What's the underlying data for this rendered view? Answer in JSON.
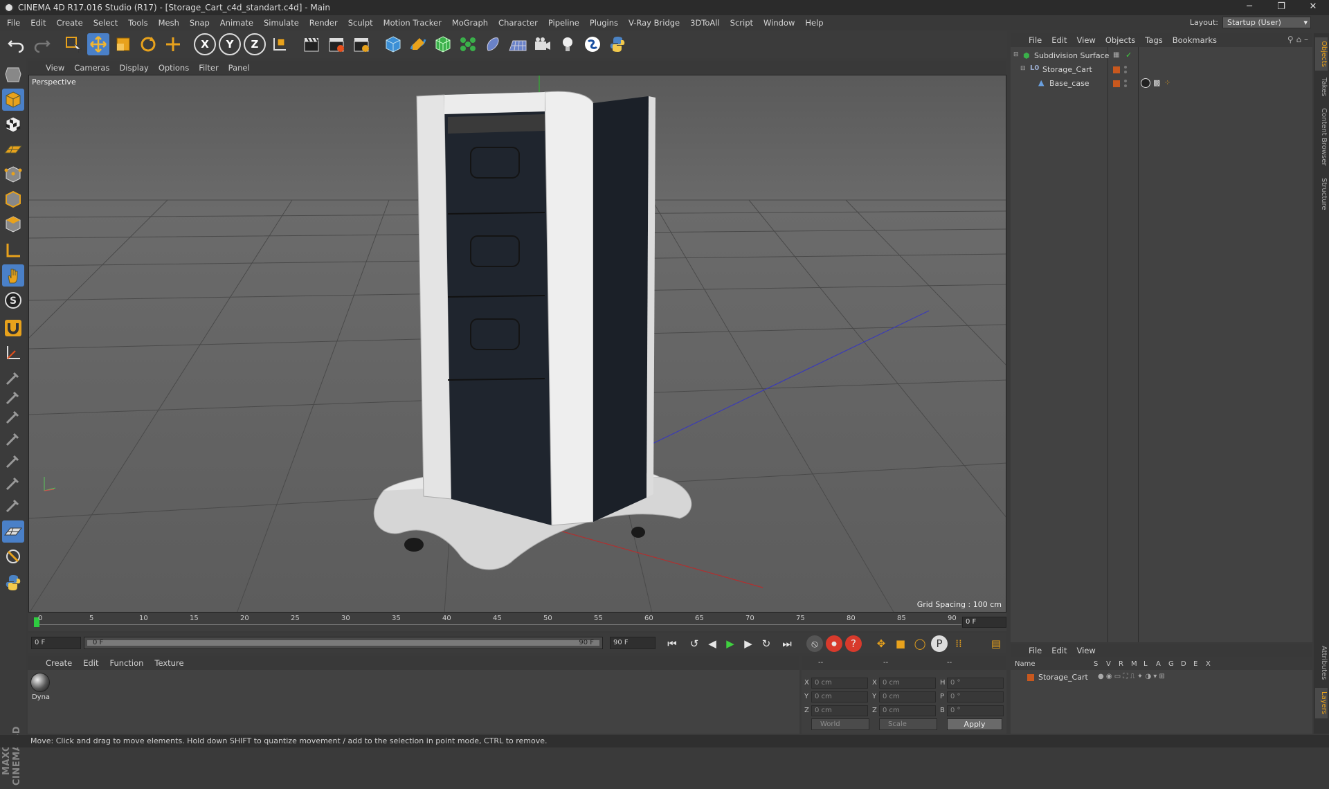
{
  "window": {
    "title": "CINEMA 4D R17.016 Studio (R17) - [Storage_Cart_c4d_standart.c4d] - Main",
    "controls": [
      "─",
      "❐",
      "✕"
    ]
  },
  "menubar": {
    "items": [
      "File",
      "Edit",
      "Create",
      "Select",
      "Tools",
      "Mesh",
      "Snap",
      "Animate",
      "Simulate",
      "Render",
      "Sculpt",
      "Motion Tracker",
      "MoGraph",
      "Character",
      "Pipeline",
      "Plugins",
      "V-Ray Bridge",
      "3DToAll",
      "Script",
      "Window",
      "Help"
    ],
    "layout_label": "Layout:",
    "layout_value": "Startup (User)"
  },
  "toolbar": {
    "x_label": "X",
    "y_label": "Y",
    "z_label": "Z"
  },
  "viewport": {
    "menu": [
      "View",
      "Cameras",
      "Display",
      "Options",
      "Filter",
      "Panel"
    ],
    "label": "Perspective",
    "grid_spacing": "Grid Spacing : 100 cm"
  },
  "timeline": {
    "ticks": [
      "0",
      "5",
      "10",
      "15",
      "20",
      "25",
      "30",
      "35",
      "40",
      "45",
      "50",
      "55",
      "60",
      "65",
      "70",
      "75",
      "80",
      "85",
      "90"
    ],
    "current_frame": "0 F"
  },
  "transport": {
    "start_field": "0 F",
    "range_start": "0 F",
    "range_end": "90 F",
    "end_field": "90 F"
  },
  "material_manager": {
    "menu": [
      "Create",
      "Edit",
      "Function",
      "Texture"
    ],
    "materials": [
      {
        "name": "Dyna"
      }
    ]
  },
  "coordinates": {
    "header_cols": [
      "--",
      "--",
      "--"
    ],
    "rows": [
      {
        "l1": "X",
        "v1": "0 cm",
        "l2": "X",
        "v2": "0 cm",
        "l3": "H",
        "v3": "0 °"
      },
      {
        "l1": "Y",
        "v1": "0 cm",
        "l2": "Y",
        "v2": "0 cm",
        "l3": "P",
        "v3": "0 °"
      },
      {
        "l1": "Z",
        "v1": "0 cm",
        "l2": "Z",
        "v2": "0 cm",
        "l3": "B",
        "v3": "0 °"
      }
    ],
    "space": "World",
    "mode": "Scale",
    "apply_label": "Apply"
  },
  "status": {
    "text": "Move: Click and drag to move elements. Hold down SHIFT to quantize movement / add to the selection in point mode, CTRL to remove."
  },
  "object_manager": {
    "menu": [
      "File",
      "Edit",
      "View",
      "Objects",
      "Tags",
      "Bookmarks"
    ],
    "objects": [
      {
        "name": "Subdivision Surface"
      },
      {
        "name": "Storage_Cart"
      },
      {
        "name": "Base_case"
      }
    ]
  },
  "side_tabs": [
    "Objects",
    "Takes",
    "Content Browser",
    "Structure",
    "Attributes",
    "Layers"
  ],
  "layer_manager": {
    "menu": [
      "File",
      "Edit",
      "View"
    ],
    "columns": [
      "Name",
      "S",
      "V",
      "R",
      "M",
      "L",
      "A",
      "G",
      "D",
      "E",
      "X"
    ],
    "layers": [
      {
        "name": "Storage_Cart"
      }
    ]
  },
  "brand": {
    "maxon": "MAXON CINEMA 4D"
  },
  "colors": {
    "accent_orange": "#e8a21c",
    "layer_orange": "#c8581e",
    "active_blue": "#4a80c8"
  }
}
